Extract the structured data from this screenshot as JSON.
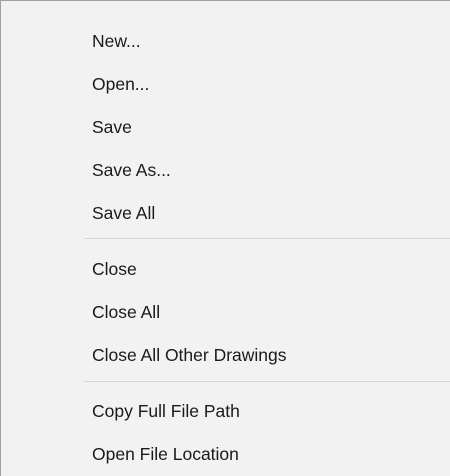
{
  "menu": {
    "groups": [
      {
        "items": [
          {
            "label": "New..."
          },
          {
            "label": "Open..."
          },
          {
            "label": "Save"
          },
          {
            "label": "Save As..."
          },
          {
            "label": "Save All"
          }
        ]
      },
      {
        "items": [
          {
            "label": "Close"
          },
          {
            "label": "Close All"
          },
          {
            "label": "Close All Other Drawings"
          }
        ]
      },
      {
        "items": [
          {
            "label": "Copy Full File Path"
          },
          {
            "label": "Open File Location"
          }
        ]
      }
    ]
  }
}
